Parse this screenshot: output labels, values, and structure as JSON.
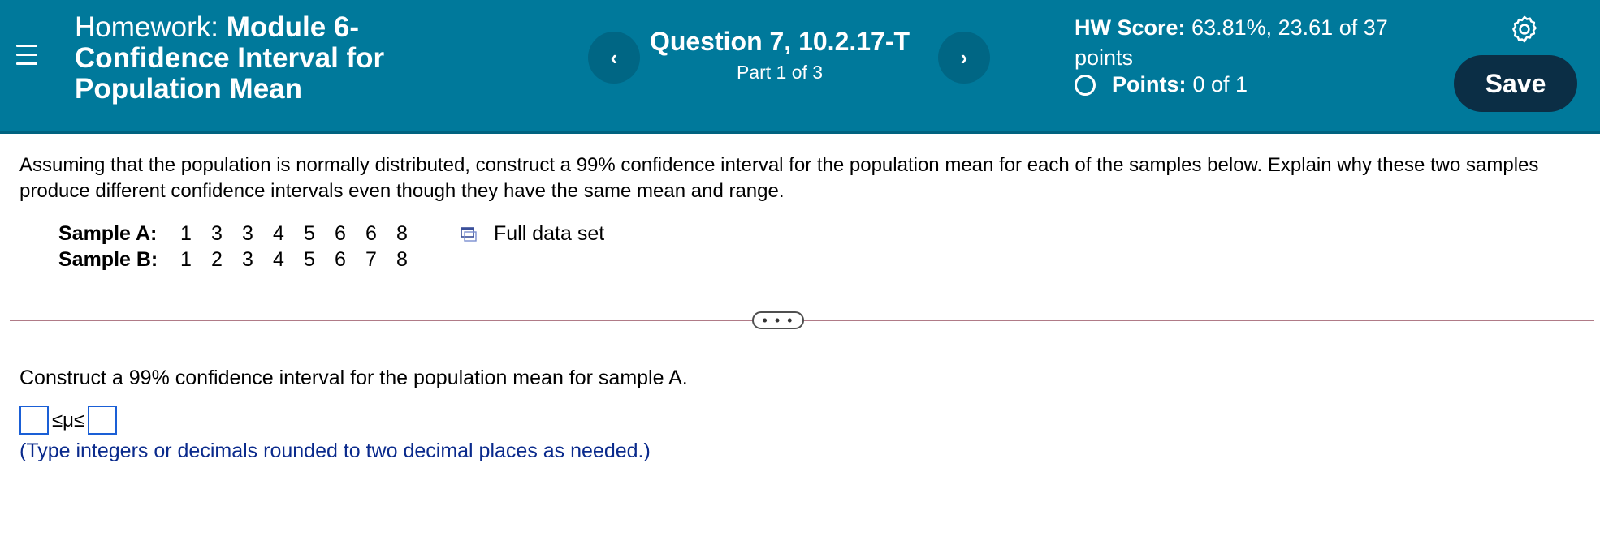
{
  "header": {
    "title_prefix": "Homework:",
    "title_main": "Module 6-Confidence Interval for Population Mean",
    "question_title": "Question 7, 10.2.17-T",
    "question_part": "Part 1 of 3",
    "prev_icon": "‹",
    "next_icon": "›",
    "hw_score_label": "HW Score:",
    "hw_score_value": "63.81%, 23.61 of 37 points",
    "points_label": "Points:",
    "points_value": "0 of 1",
    "save_label": "Save",
    "icons": [
      "menu-icon",
      "chevron-left-icon",
      "chevron-right-icon",
      "radio-circle-icon",
      "gear-icon"
    ],
    "colors": {
      "bar": "#00799b",
      "nav_button": "#006684",
      "save_button": "#0b2e45"
    }
  },
  "problem": {
    "prompt": "Assuming that the population is normally distributed, construct a 99% confidence interval for the population mean for each of the samples below. Explain why these two samples produce different confidence intervals even though they have the same mean and range.",
    "samples": [
      {
        "label": "Sample A:",
        "values": [
          "1",
          "3",
          "3",
          "4",
          "5",
          "6",
          "6",
          "8"
        ]
      },
      {
        "label": "Sample B:",
        "values": [
          "1",
          "2",
          "3",
          "4",
          "5",
          "6",
          "7",
          "8"
        ]
      }
    ],
    "full_data_set_label": "Full data set"
  },
  "more_button_label": "• • •",
  "subquestion": {
    "text": "Construct a 99% confidence interval for the population mean for sample A.",
    "inequality": "≤μ≤",
    "lower_value": "",
    "upper_value": "",
    "hint": "(Type integers or decimals rounded to two decimal places as needed.)"
  }
}
